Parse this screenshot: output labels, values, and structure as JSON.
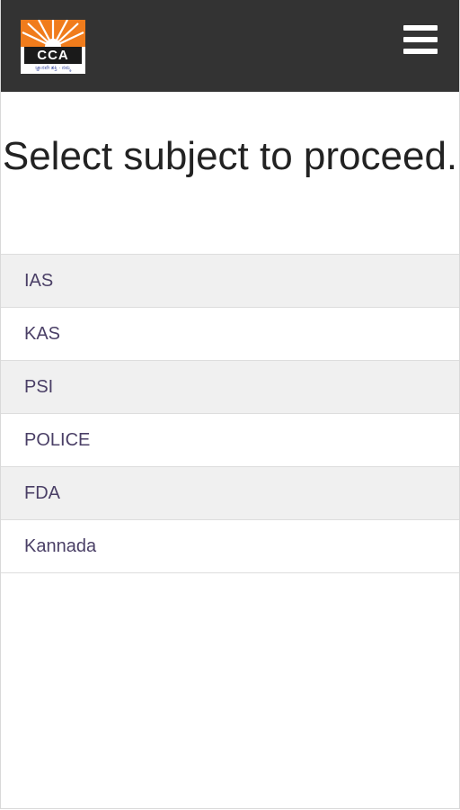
{
  "header": {
    "logo_text": "CCA",
    "logo_tagline": "ಜ್ಞಾನವೇ ಶಕ್ತಿ · ನಮ್ಮ",
    "menu_icon": "hamburger-menu-icon",
    "background_color": "#333333",
    "logo_accent_color": "#f07c1c"
  },
  "main": {
    "title": "Select subject to proceed.",
    "subjects": [
      {
        "label": "IAS"
      },
      {
        "label": "KAS"
      },
      {
        "label": "PSI"
      },
      {
        "label": "POLICE"
      },
      {
        "label": "FDA"
      },
      {
        "label": "Kannada"
      }
    ]
  }
}
